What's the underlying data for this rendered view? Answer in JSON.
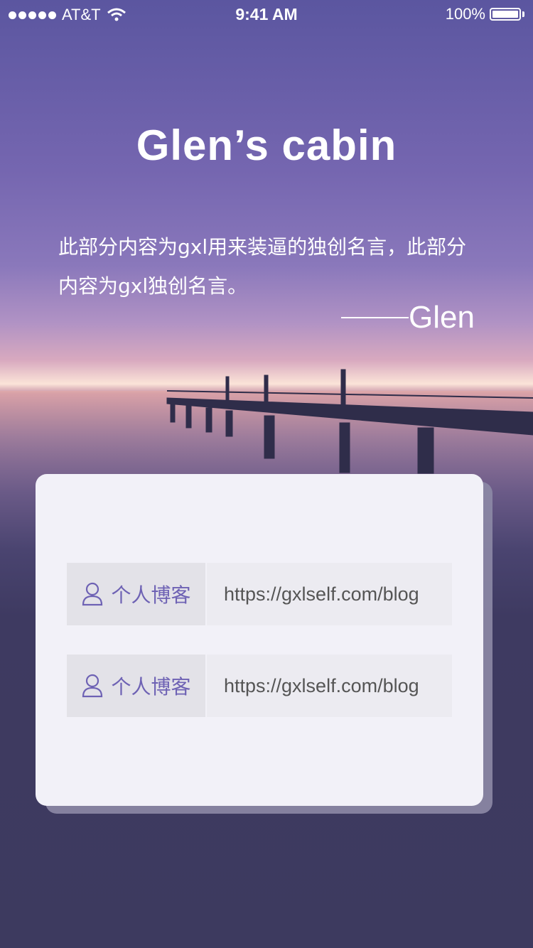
{
  "status_bar": {
    "carrier": "AT&T",
    "time": "9:41 AM",
    "battery": "100%"
  },
  "header": {
    "title": "Glen’s cabin"
  },
  "quote": {
    "text": "此部分内容为gxl用来装逼的独创名言，此部分内容为gxl独创名言。",
    "signature": "Glen"
  },
  "links": [
    {
      "label": "个人博客",
      "url": "https://gxlself.com/blog",
      "icon": "user-icon"
    },
    {
      "label": "个人博客",
      "url": "https://gxlself.com/blog",
      "icon": "user-icon"
    }
  ],
  "colors": {
    "accent": "#6e62b4",
    "card_bg": "#f2f1f8",
    "page_bg": "#3d3a5f"
  }
}
